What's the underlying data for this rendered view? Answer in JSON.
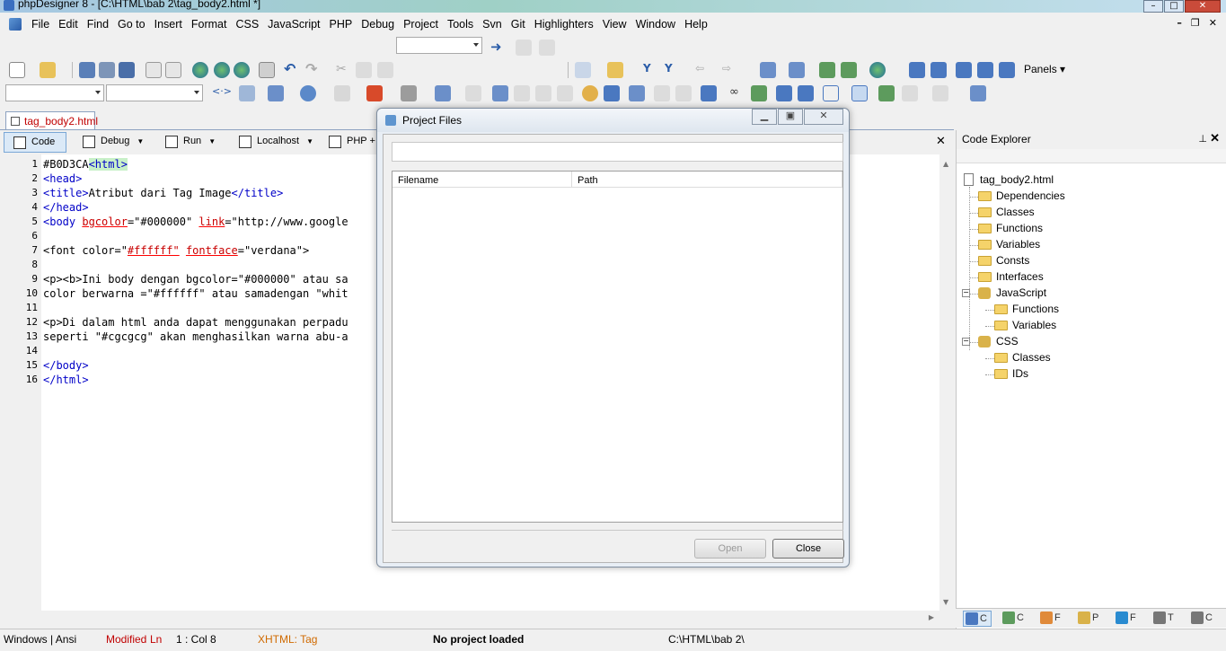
{
  "window": {
    "title": "phpDesigner 8 - [C:\\HTML\\bab 2\\tag_body2.html *]"
  },
  "menu": {
    "items": [
      "File",
      "Edit",
      "Find",
      "Go to",
      "Insert",
      "Format",
      "CSS",
      "JavaScript",
      "PHP",
      "Debug",
      "Project",
      "Tools",
      "Svn",
      "Git",
      "Highlighters",
      "View",
      "Window",
      "Help"
    ]
  },
  "toolbar": {
    "panels_label": "Panels"
  },
  "document_tab": {
    "label": "tag_body2.html"
  },
  "modes": {
    "code": "Code",
    "debug": "Debug",
    "run": "Run",
    "localhost": "Localhost",
    "php": "PHP + X"
  },
  "editor": {
    "lines": [
      {
        "n": "1",
        "segments": [
          {
            "t": "#B0D3CA",
            "c": "plain"
          },
          {
            "t": "<html>",
            "c": "tag-hl"
          }
        ]
      },
      {
        "n": "2",
        "segments": [
          {
            "t": "<head>",
            "c": "tag"
          }
        ]
      },
      {
        "n": "3",
        "segments": [
          {
            "t": "<title>",
            "c": "tag"
          },
          {
            "t": "Atribut dari Tag Image",
            "c": "plain"
          },
          {
            "t": "</title>",
            "c": "tag"
          }
        ]
      },
      {
        "n": "4",
        "segments": [
          {
            "t": "</head>",
            "c": "tag"
          }
        ]
      },
      {
        "n": "5",
        "segments": [
          {
            "t": "<body ",
            "c": "tag"
          },
          {
            "t": "bgcolor",
            "c": "attr-err"
          },
          {
            "t": "=\"#000000\" ",
            "c": "plain"
          },
          {
            "t": "link",
            "c": "attr-err"
          },
          {
            "t": "=\"http://www.google",
            "c": "plain"
          }
        ]
      },
      {
        "n": "6",
        "segments": []
      },
      {
        "n": "7",
        "segments": [
          {
            "t": "<font color=\"",
            "c": "plain"
          },
          {
            "t": "#ffffff\"",
            "c": "attr-err"
          },
          {
            "t": " ",
            "c": "plain"
          },
          {
            "t": "fontface",
            "c": "attr-err"
          },
          {
            "t": "=\"verdana\">",
            "c": "plain"
          }
        ]
      },
      {
        "n": "8",
        "segments": []
      },
      {
        "n": "9",
        "segments": [
          {
            "t": "<p><b>Ini body dengan bgcolor=\"#000000\" atau sa",
            "c": "plain"
          }
        ]
      },
      {
        "n": "10",
        "segments": [
          {
            "t": "color berwarna =\"#ffffff\" atau samadengan \"whit",
            "c": "plain"
          }
        ]
      },
      {
        "n": "11",
        "segments": []
      },
      {
        "n": "12",
        "segments": [
          {
            "t": "<p>Di dalam html anda dapat menggunakan perpadu",
            "c": "plain"
          }
        ]
      },
      {
        "n": "13",
        "segments": [
          {
            "t": "seperti \"#cgcgcg\" akan menghasilkan warna abu-a",
            "c": "plain"
          }
        ]
      },
      {
        "n": "14",
        "segments": []
      },
      {
        "n": "15",
        "segments": [
          {
            "t": "</body>",
            "c": "tag"
          }
        ]
      },
      {
        "n": "16",
        "segments": [
          {
            "t": "</html>",
            "c": "tag"
          }
        ]
      }
    ]
  },
  "explorer": {
    "title": "Code Explorer",
    "tree": [
      {
        "label": "tag_body2.html",
        "icon": "file-icon",
        "level": 0
      },
      {
        "label": "Dependencies",
        "icon": "folder-icon",
        "level": 1
      },
      {
        "label": "Classes",
        "icon": "folder-icon",
        "level": 1
      },
      {
        "label": "Functions",
        "icon": "folder-icon",
        "level": 1
      },
      {
        "label": "Variables",
        "icon": "folder-icon",
        "level": 1
      },
      {
        "label": "Consts",
        "icon": "folder-icon",
        "level": 1
      },
      {
        "label": "Interfaces",
        "icon": "folder-icon",
        "level": 1
      },
      {
        "label": "JavaScript",
        "icon": "puzzle-icon",
        "level": 1,
        "expander": true
      },
      {
        "label": "Functions",
        "icon": "folder-icon",
        "level": 2
      },
      {
        "label": "Variables",
        "icon": "folder-icon",
        "level": 2
      },
      {
        "label": "CSS",
        "icon": "puzzle-icon",
        "level": 1,
        "expander": true
      },
      {
        "label": "Classes",
        "icon": "folder-icon",
        "level": 2
      },
      {
        "label": "IDs",
        "icon": "folder-icon",
        "level": 2
      }
    ],
    "bottom_tabs": [
      "C",
      "C",
      "F",
      "P",
      "F",
      "T",
      "C"
    ]
  },
  "dialog": {
    "title": "Project Files",
    "search_value": "",
    "columns": [
      "Filename",
      "Path"
    ],
    "open_label": "Open",
    "close_label": "Close"
  },
  "status": {
    "platform": "Windows | Ansi",
    "modified": "Modified",
    "ln_label": "Ln",
    "position": "1 : Col   8",
    "mode": "XHTML: Tag",
    "project": "No project loaded",
    "path": "C:\\HTML\\bab 2\\"
  }
}
